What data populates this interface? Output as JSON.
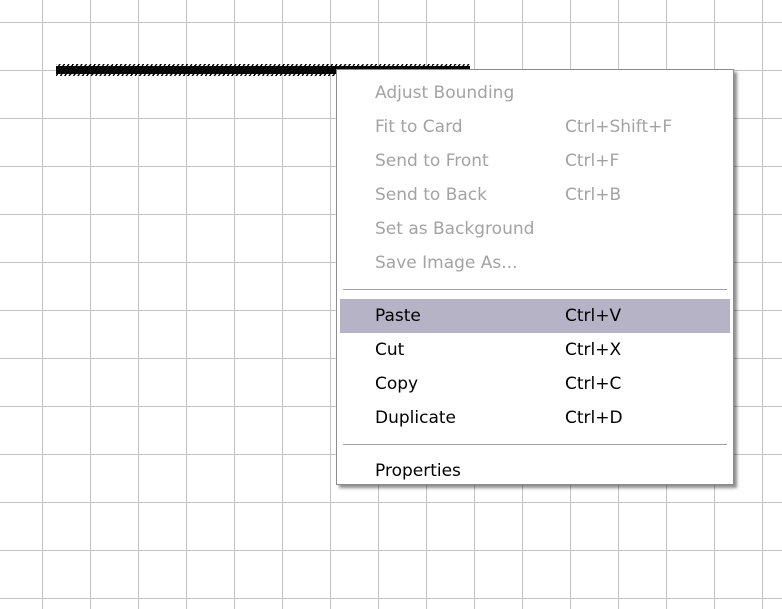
{
  "context_menu": {
    "items": [
      {
        "label": "Adjust Bounding",
        "shortcut": "",
        "enabled": false
      },
      {
        "label": "Fit to Card",
        "shortcut": "Ctrl+Shift+F",
        "enabled": false
      },
      {
        "label": "Send to Front",
        "shortcut": "Ctrl+F",
        "enabled": false
      },
      {
        "label": "Send to Back",
        "shortcut": "Ctrl+B",
        "enabled": false
      },
      {
        "label": "Set as Background",
        "shortcut": "",
        "enabled": false
      },
      {
        "label": "Save Image As...",
        "shortcut": "",
        "enabled": false
      },
      {
        "label": "Paste",
        "shortcut": "Ctrl+V",
        "enabled": true,
        "highlighted": true
      },
      {
        "label": "Cut",
        "shortcut": "Ctrl+X",
        "enabled": true
      },
      {
        "label": "Copy",
        "shortcut": "Ctrl+C",
        "enabled": true
      },
      {
        "label": "Duplicate",
        "shortcut": "Ctrl+D",
        "enabled": true
      },
      {
        "label": "Properties",
        "shortcut": "",
        "enabled": true
      }
    ]
  },
  "colors": {
    "grid_line": "#c3c3c3",
    "highlight": "#b6b3c6",
    "disabled_text": "#a3a3a3",
    "menu_border": "#8c8c8c"
  }
}
